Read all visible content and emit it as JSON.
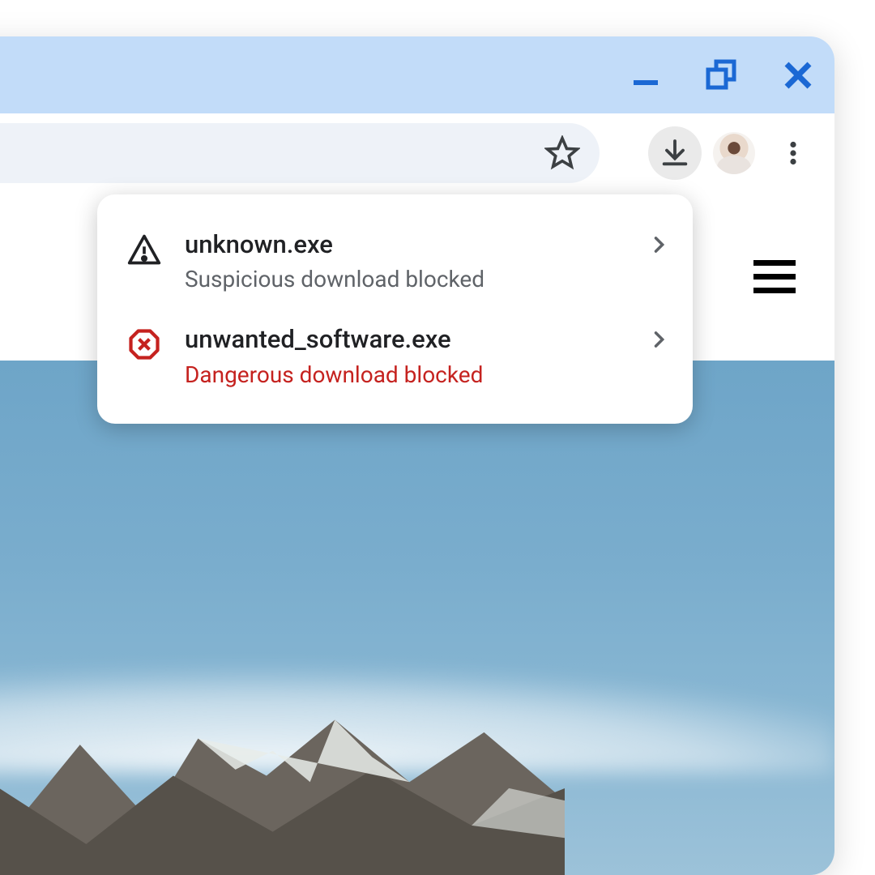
{
  "downloads": [
    {
      "filename": "unknown.exe",
      "status": "Suspicious download blocked",
      "warning_level": "suspicious",
      "icon": "warning-triangle-icon"
    },
    {
      "filename": "unwanted_software.exe",
      "status": "Dangerous download blocked",
      "warning_level": "dangerous",
      "icon": "block-octagon-icon"
    }
  ],
  "window_controls": {
    "minimize": "minimize",
    "restore": "restore",
    "close": "close"
  },
  "toolbar": {
    "bookmark": "bookmark",
    "downloads": "downloads",
    "profile": "profile",
    "menu": "menu"
  },
  "colors": {
    "titlebar_bg": "#c2dcf9",
    "control_blue": "#1b68d4",
    "danger_red": "#c5221f",
    "text_primary": "#202124",
    "text_secondary": "#5f6368"
  }
}
